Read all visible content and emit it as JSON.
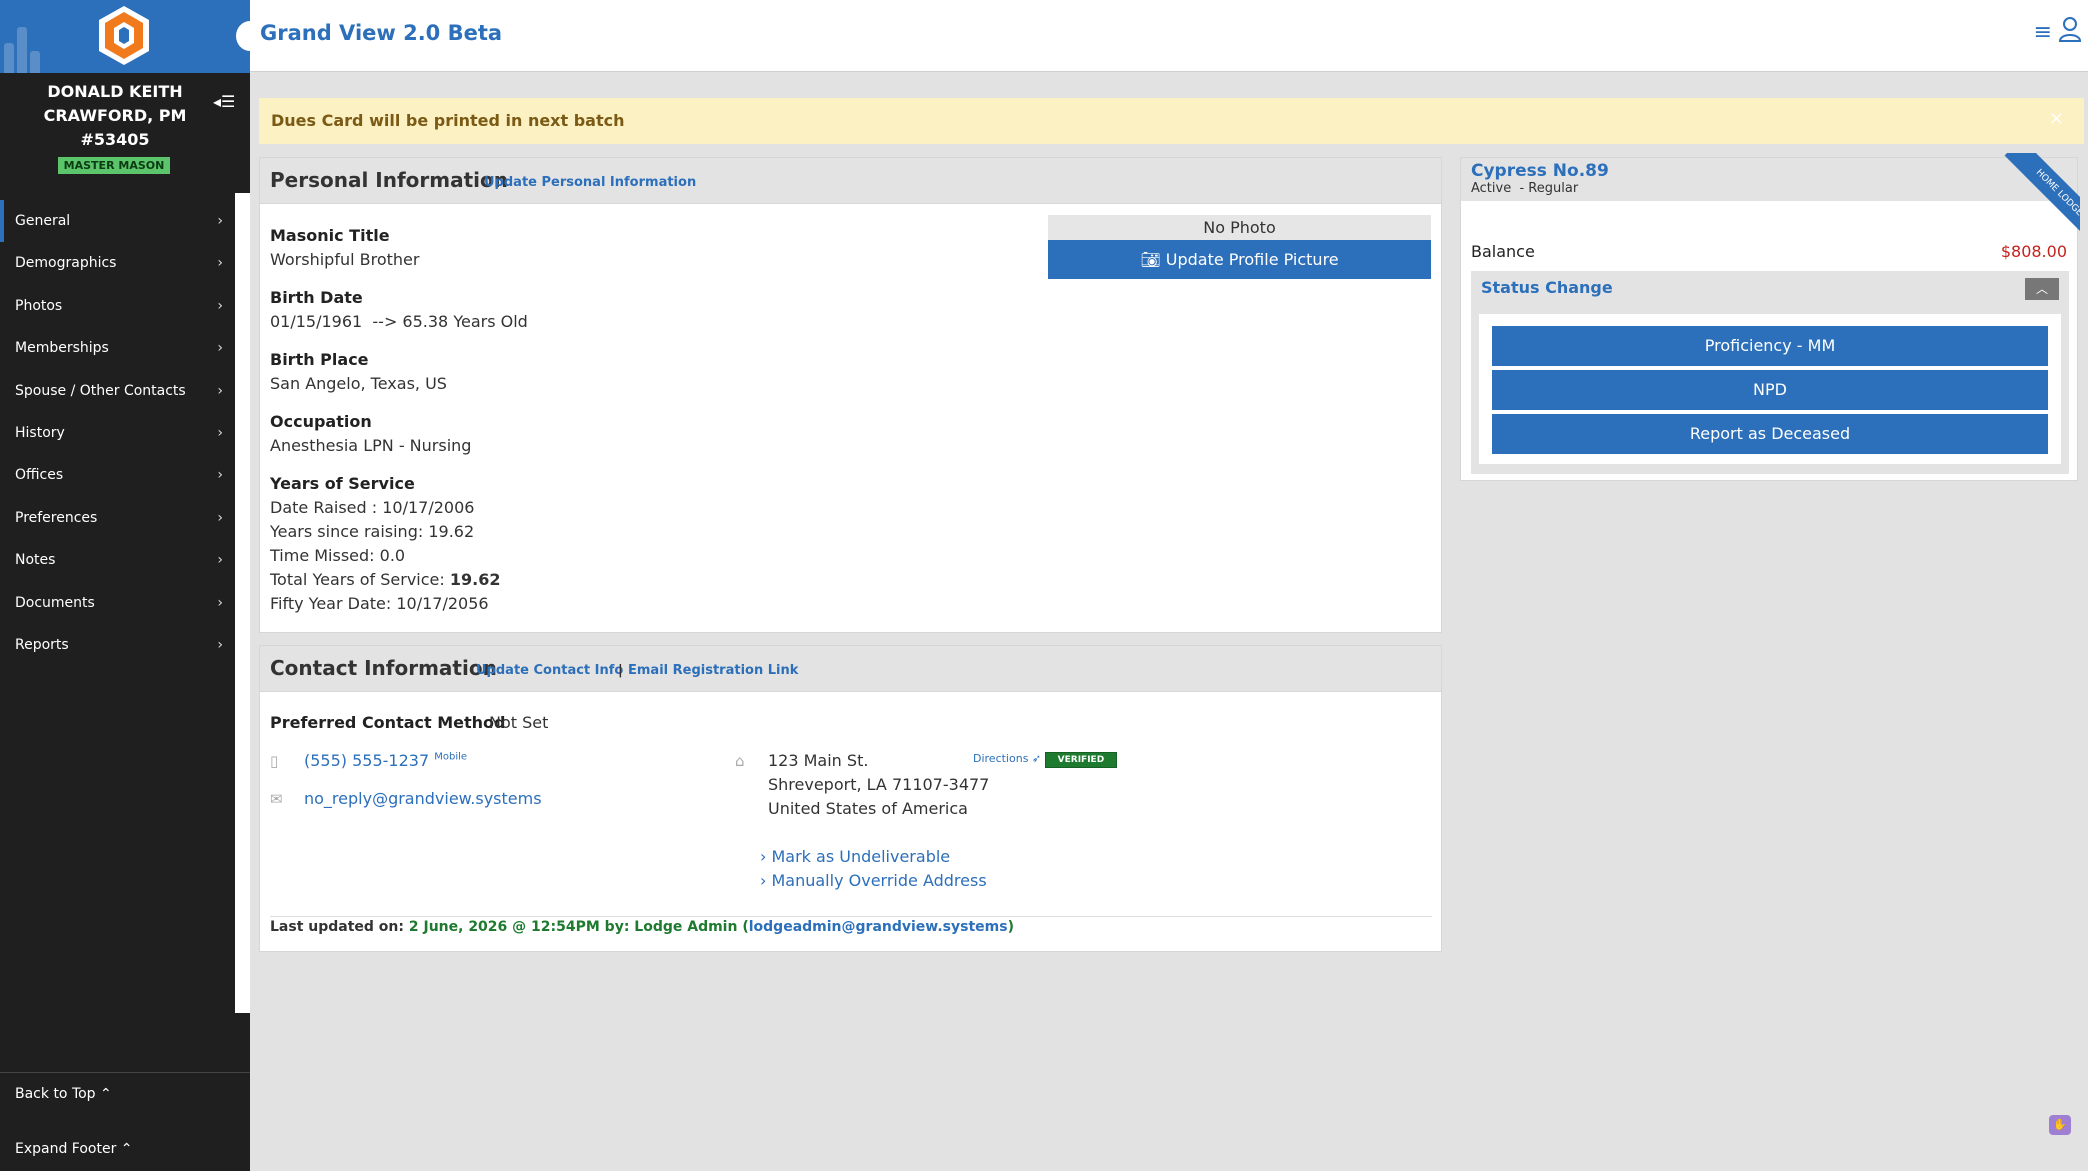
{
  "app": {
    "title": "Grand View 2.0 Beta"
  },
  "member": {
    "name": "DONALD KEITH CRAWFORD, PM #53405",
    "rank": "MASTER MASON"
  },
  "nav": {
    "items": [
      {
        "label": "General"
      },
      {
        "label": "Demographics"
      },
      {
        "label": "Photos"
      },
      {
        "label": "Memberships"
      },
      {
        "label": "Spouse / Other Contacts"
      },
      {
        "label": "History"
      },
      {
        "label": "Offices"
      },
      {
        "label": "Preferences"
      },
      {
        "label": "Notes"
      },
      {
        "label": "Documents"
      },
      {
        "label": "Reports"
      }
    ],
    "back_to_top": "Back to Top ⌃",
    "expand_footer": "Expand Footer ⌃"
  },
  "alert": {
    "text": "Dues Card will be printed in next batch",
    "close": "×"
  },
  "personal": {
    "title": "Personal Information",
    "update_link": "Update Personal Information",
    "masonic_title_label": "Masonic Title",
    "masonic_title": "Worshipful Brother",
    "birth_date_label": "Birth Date",
    "birth_date": "01/15/1961  --> 65.38 Years Old",
    "birth_place_label": "Birth Place",
    "birth_place": "San Angelo, Texas, US",
    "occupation_label": "Occupation",
    "occupation": "Anesthesia LPN - Nursing",
    "service_label": "Years of Service",
    "date_raised": "Date Raised : 10/17/2006",
    "years_since": "Years since raising: 19.62",
    "time_missed": "Time Missed: 0.0",
    "total_service_label": "Total Years of Service: ",
    "total_service_value": "19.62",
    "fifty_year": "Fifty Year Date: 10/17/2056",
    "no_photo": "No Photo",
    "update_photo": "Update Profile Picture"
  },
  "contact": {
    "title": "Contact Information",
    "update_link": "Update Contact Info",
    "separator": "|",
    "email_reg_link": "Email Registration Link",
    "preferred_label": "Preferred Contact Method",
    "preferred_value": "Not Set",
    "phone": "(555) 555-1237",
    "phone_type": "Mobile",
    "email": "no_reply@grandview.systems",
    "address_line1": "123 Main St.",
    "address_line2": "Shreveport, LA 71107-3477",
    "address_line3": "United States of America",
    "directions": "Directions",
    "verified": "VERIFIED",
    "mark_undeliverable": "Mark as Undeliverable",
    "override_address": "Manually Override Address",
    "last_updated_label": "Last updated on: ",
    "last_updated_date": "2 June, 2026 @ 12:54PM",
    "last_updated_by": " by: Lodge Admin (",
    "last_updated_email": "lodgeadmin@grandview.systems",
    "last_updated_close": ")"
  },
  "lodge": {
    "name": "Cypress No.89",
    "status": "Active  - Regular",
    "ribbon": "HOME LODGE",
    "balance_label": "Balance",
    "balance_value": "$808.00",
    "status_change_title": "Status Change",
    "buttons": [
      "Proficiency - MM",
      "NPD",
      "Report as Deceased"
    ]
  },
  "colors": {
    "brand": "#2c6fba",
    "sidebar": "#1f1f1f",
    "alert_bg": "#fcf1c3",
    "balance": "#c5221f",
    "verified": "#1d7a2e"
  }
}
